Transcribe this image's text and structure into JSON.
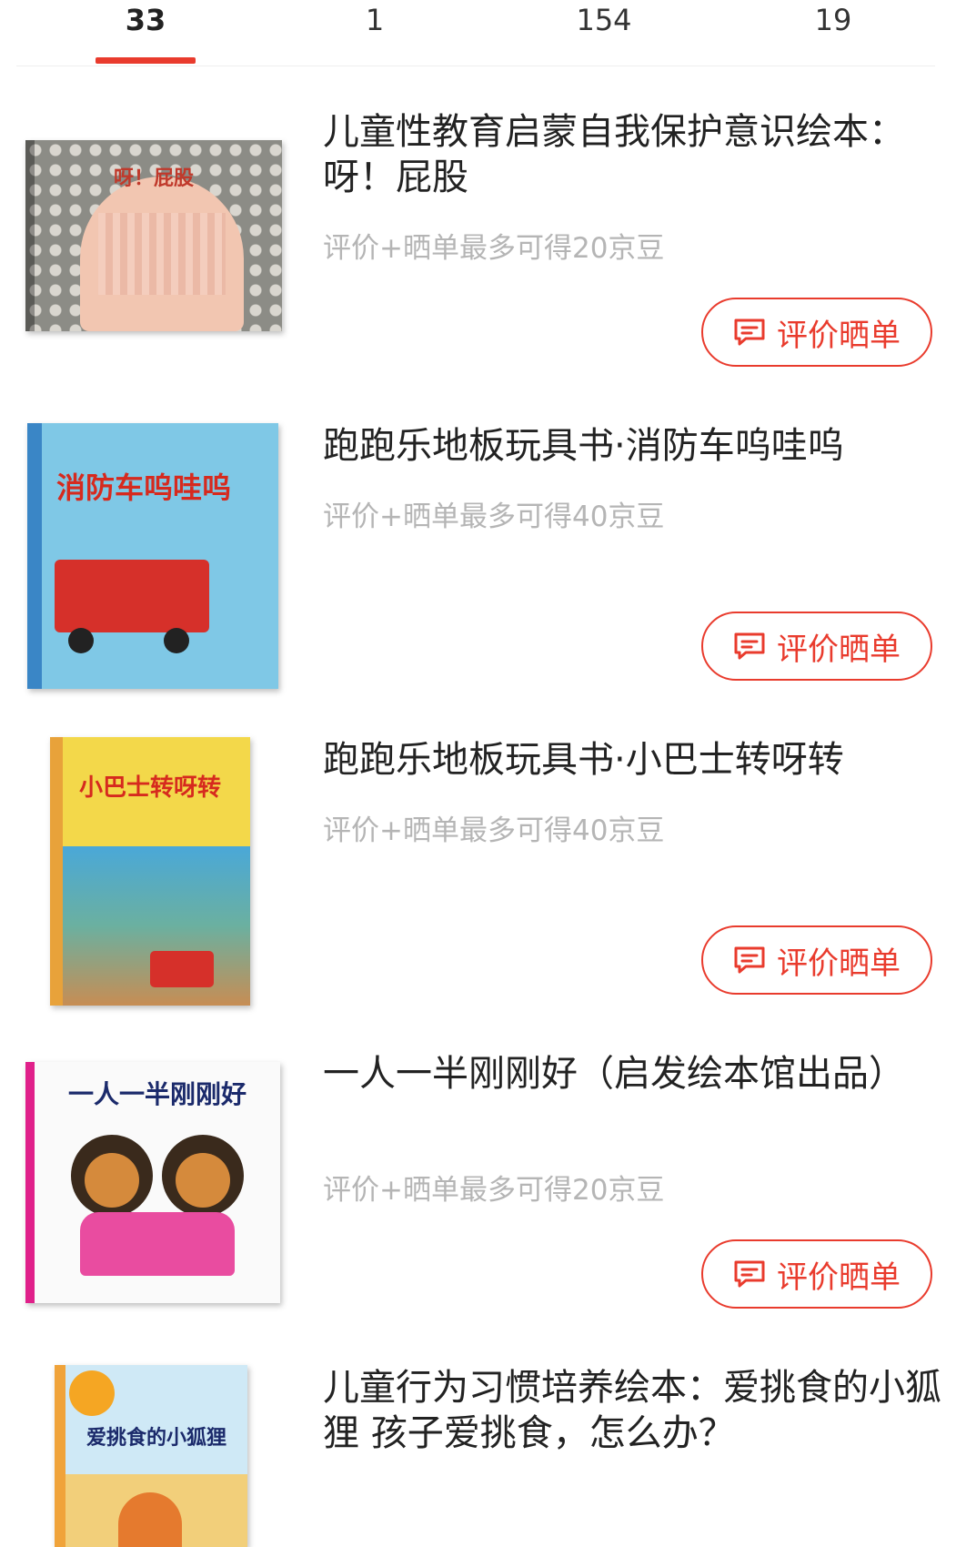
{
  "tabs": [
    {
      "label": "33",
      "active": true
    },
    {
      "label": "1",
      "active": false
    },
    {
      "label": "154",
      "active": false
    },
    {
      "label": "19",
      "active": false
    }
  ],
  "items": [
    {
      "title": "儿童性教育启蒙自我保护意识绘本：呀！屁股",
      "reward": "评价+晒单最多可得20京豆",
      "button": "评价晒单",
      "cover_text": "呀！屁股"
    },
    {
      "title": "跑跑乐地板玩具书·消防车呜哇呜",
      "reward": "评价+晒单最多可得40京豆",
      "button": "评价晒单",
      "cover_text": "消防车呜哇呜"
    },
    {
      "title": "跑跑乐地板玩具书·小巴士转呀转",
      "reward": "评价+晒单最多可得40京豆",
      "button": "评价晒单",
      "cover_text": "小巴士转呀转"
    },
    {
      "title": "一人一半刚刚好（启发绘本馆出品）",
      "reward": "评价+晒单最多可得20京豆",
      "button": "评价晒单",
      "cover_text": "一人一半刚刚好"
    },
    {
      "title": "儿童行为习惯培养绘本：爱挑食的小狐狸 孩子爱挑食，怎么办？",
      "reward": "",
      "button": "",
      "cover_text": "爱挑食的小狐狸"
    }
  ],
  "colors": {
    "accent": "#e93b2d",
    "muted": "#b5b5b5",
    "text": "#222222"
  },
  "icons": {
    "review_button": "chat-bubble-icon"
  }
}
